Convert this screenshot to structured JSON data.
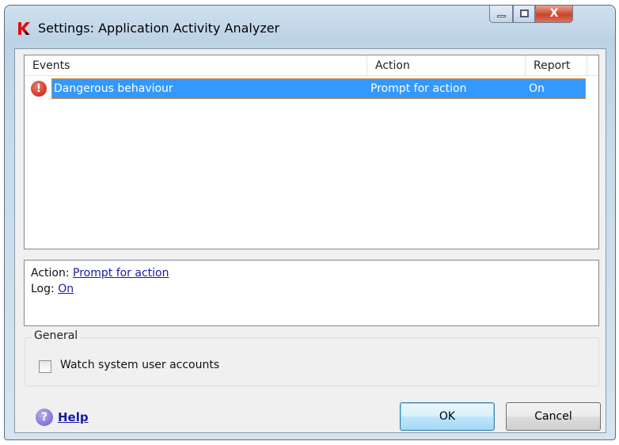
{
  "window": {
    "title": "Settings: Application Activity Analyzer",
    "controls": {
      "minimize": "minimize",
      "maximize": "maximize",
      "close": "X"
    }
  },
  "list": {
    "columns": [
      "Events",
      "Action",
      "Report"
    ],
    "rows": [
      {
        "event": "Dangerous behaviour",
        "action": "Prompt for action",
        "report": "On",
        "icon": "error-icon",
        "selected": true
      }
    ]
  },
  "details": {
    "action_label": "Action:",
    "action_value": "Prompt for action",
    "log_label": "Log:",
    "log_value": "On"
  },
  "general": {
    "title": "General",
    "watch_label": "Watch system user accounts",
    "watch_checked": false
  },
  "footer": {
    "help": "Help",
    "ok": "OK",
    "cancel": "Cancel"
  },
  "colors": {
    "selection": "#3399ff",
    "link": "#1a1aa8"
  }
}
